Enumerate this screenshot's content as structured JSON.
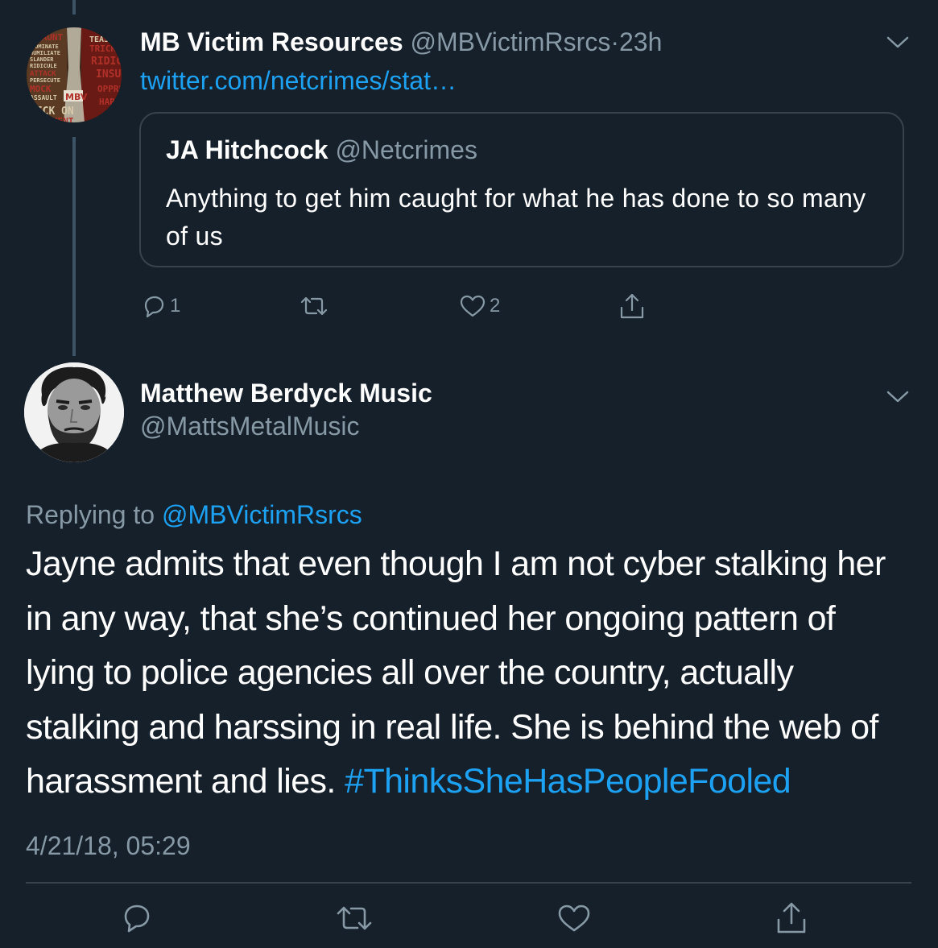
{
  "colors": {
    "background": "#15202b",
    "text_primary": "#ffffff",
    "text_secondary": "#8899a6",
    "accent_link": "#1da1f2",
    "border": "#38444d",
    "thread_line": "#3d5466"
  },
  "parent_tweet": {
    "author_name": "MB Victim Resources",
    "author_handle": "@MBVictimRsrcs",
    "separator": "·",
    "time_ago": "23h",
    "link_text": "twitter.com/netcrimes/stat…",
    "avatar": {
      "type": "logo",
      "text_lines": [
        "TAUNT",
        "DOMINATE",
        "HUMILIATE",
        "SLANDER",
        "RIDICULE",
        "ATTACK",
        "PERSECUTE",
        "MOCK",
        "ASSAULT",
        "PICK ON",
        "TORMENT",
        "TEASE",
        "TRICK",
        "RIDICL",
        "INSUL",
        "OPPRE",
        "HAR",
        "MBV"
      ]
    },
    "menu_icon": "chevron-down-icon",
    "quoted_tweet": {
      "author_name": "JA Hitchcock",
      "author_handle": "@Netcrimes",
      "text": "Anything to get him caught for what he has done to so many of us"
    },
    "actions": [
      {
        "icon": "reply-icon",
        "count": "1"
      },
      {
        "icon": "retweet-icon",
        "count": ""
      },
      {
        "icon": "like-icon",
        "count": "2"
      },
      {
        "icon": "share-icon",
        "count": ""
      }
    ]
  },
  "main_tweet": {
    "author_name": "Matthew Berdyck Music",
    "author_handle": "@MattsMetalMusic",
    "menu_icon": "chevron-down-icon",
    "replying_prefix": "Replying to",
    "replying_to": "@MBVictimRsrcs",
    "text": "Jayne admits that even though I am not cyber stalking her in any way, that she’s continued her ongoing pattern of lying to police agencies all over the country, actually stalking and harssing in real life.  She is behind the web of harassment and lies.",
    "hashtag": "#ThinksSheHasPeopleFooled",
    "timestamp": "4/21/18, 05:29",
    "actions": [
      {
        "icon": "reply-icon"
      },
      {
        "icon": "retweet-icon"
      },
      {
        "icon": "like-icon"
      },
      {
        "icon": "share-icon"
      }
    ]
  }
}
